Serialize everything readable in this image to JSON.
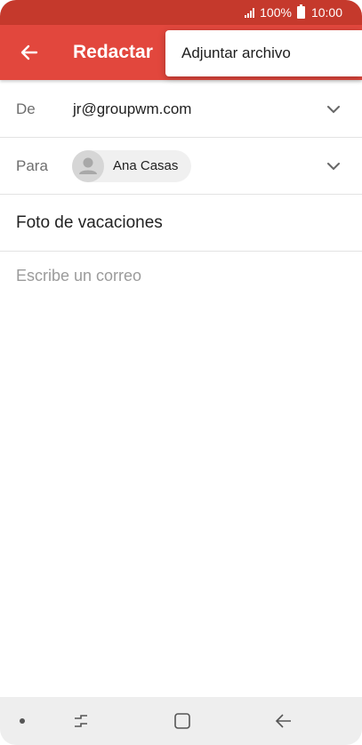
{
  "status_bar": {
    "battery": "100%",
    "time": "10:00"
  },
  "toolbar": {
    "title": "Redactar",
    "back_icon": "arrow-left-icon"
  },
  "overflow_menu": {
    "items": [
      {
        "label": "Adjuntar archivo"
      }
    ]
  },
  "compose": {
    "from_label": "De",
    "from_value": "jr@groupwm.com",
    "to_label": "Para",
    "to_recipient": "Ana Casas",
    "subject": "Foto de vacaciones",
    "body_placeholder": "Escribe un correo"
  },
  "colors": {
    "status_bar": "#c5392c",
    "toolbar": "#e2473d",
    "nav_bar": "#eeeeee"
  }
}
